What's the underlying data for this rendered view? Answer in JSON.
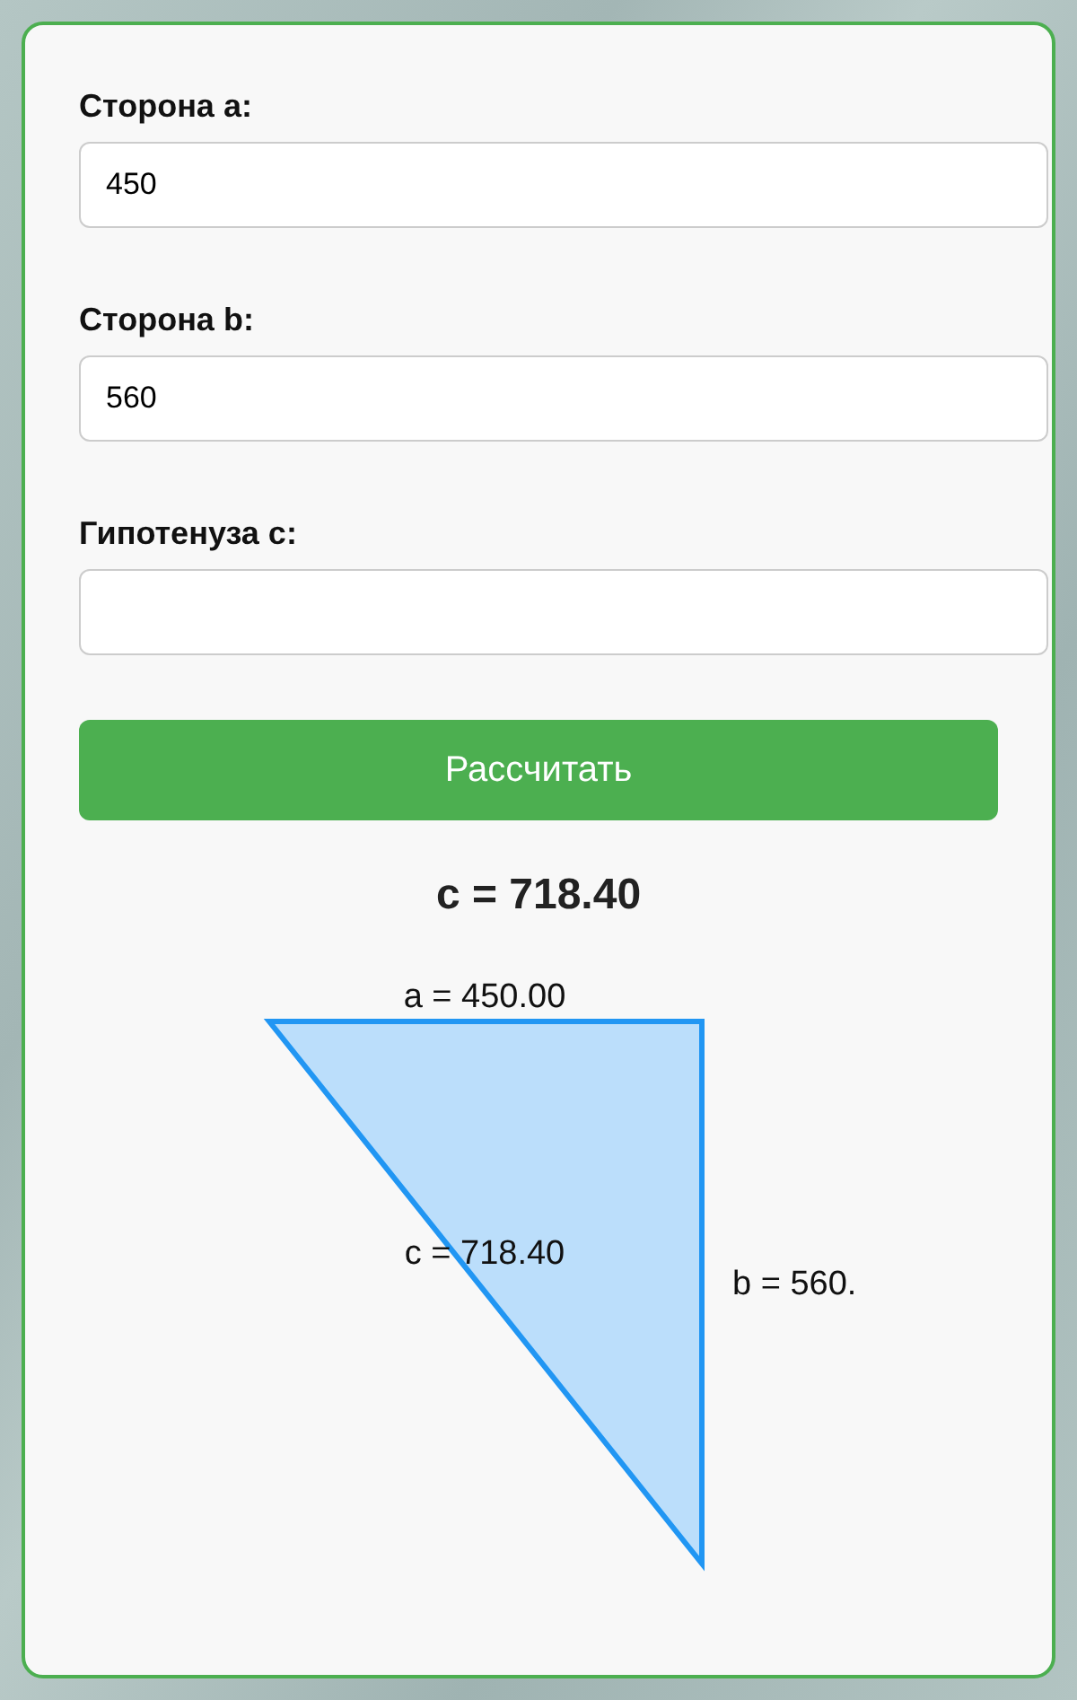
{
  "fields": [
    {
      "label": "Сторона a:",
      "value": "450"
    },
    {
      "label": "Сторона b:",
      "value": "560"
    },
    {
      "label": "Гипотенуза c:"
    }
  ],
  "calculate_button": "Рассчитать",
  "result": "c = 718.40",
  "diagram": {
    "side_a": "a = 450.00",
    "side_b": "b = 560.",
    "side_c": "c = 718.40"
  }
}
